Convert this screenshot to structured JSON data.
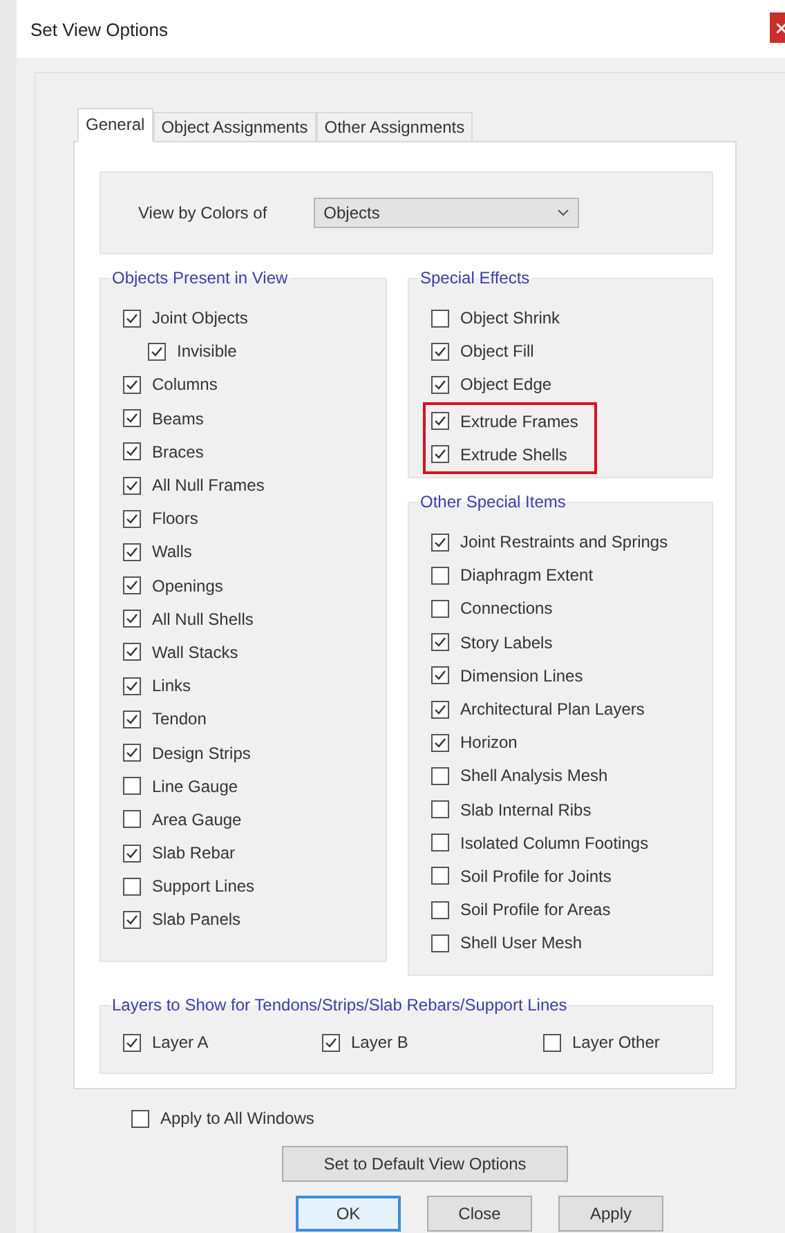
{
  "window": {
    "title": "Set View Options"
  },
  "tabs": [
    {
      "label": "General",
      "selected": true
    },
    {
      "label": "Object Assignments",
      "selected": false
    },
    {
      "label": "Other Assignments",
      "selected": false
    }
  ],
  "view_by_colors": {
    "label": "View by Colors of",
    "value": "Objects"
  },
  "objects_present": {
    "title": "Objects Present in View",
    "items": [
      {
        "label": "Joint Objects",
        "checked": true,
        "children": [
          {
            "label": "Invisible",
            "checked": true
          }
        ]
      },
      {
        "label": "Columns",
        "checked": true
      },
      {
        "label": "Beams",
        "checked": true
      },
      {
        "label": "Braces",
        "checked": true
      },
      {
        "label": "All Null Frames",
        "checked": true
      },
      {
        "label": "Floors",
        "checked": true
      },
      {
        "label": "Walls",
        "checked": true
      },
      {
        "label": "Openings",
        "checked": true
      },
      {
        "label": "All Null Shells",
        "checked": true
      },
      {
        "label": "Wall Stacks",
        "checked": true
      },
      {
        "label": "Links",
        "checked": true
      },
      {
        "label": "Tendon",
        "checked": true
      },
      {
        "label": "Design Strips",
        "checked": true
      },
      {
        "label": "Line Gauge",
        "checked": false
      },
      {
        "label": "Area Gauge",
        "checked": false
      },
      {
        "label": "Slab Rebar",
        "checked": true
      },
      {
        "label": "Support Lines",
        "checked": false
      },
      {
        "label": "Slab Panels",
        "checked": true
      }
    ]
  },
  "special_effects": {
    "title": "Special Effects",
    "items": [
      {
        "label": "Object Shrink",
        "checked": false,
        "highlighted": false
      },
      {
        "label": "Object Fill",
        "checked": true,
        "highlighted": false
      },
      {
        "label": "Object Edge",
        "checked": true,
        "highlighted": false
      },
      {
        "label": "Extrude Frames",
        "checked": true,
        "highlighted": true
      },
      {
        "label": "Extrude Shells",
        "checked": true,
        "highlighted": true
      }
    ]
  },
  "other_special_items": {
    "title": "Other Special Items",
    "items": [
      {
        "label": "Joint Restraints and Springs",
        "checked": true
      },
      {
        "label": "Diaphragm Extent",
        "checked": false
      },
      {
        "label": "Connections",
        "checked": false
      },
      {
        "label": "Story Labels",
        "checked": true
      },
      {
        "label": "Dimension Lines",
        "checked": true
      },
      {
        "label": "Architectural Plan Layers",
        "checked": true
      },
      {
        "label": "Horizon",
        "checked": true
      },
      {
        "label": "Shell Analysis Mesh",
        "checked": false
      },
      {
        "label": "Slab Internal Ribs",
        "checked": false
      },
      {
        "label": "Isolated Column Footings",
        "checked": false
      },
      {
        "label": "Soil Profile for Joints",
        "checked": false
      },
      {
        "label": "Soil Profile for Areas",
        "checked": false
      },
      {
        "label": "Shell User Mesh",
        "checked": false
      }
    ]
  },
  "layers": {
    "title": "Layers to Show for Tendons/Strips/Slab Rebars/Support Lines",
    "items": [
      {
        "label": "Layer A",
        "checked": true
      },
      {
        "label": "Layer B",
        "checked": true
      },
      {
        "label": "Layer Other",
        "checked": false
      }
    ]
  },
  "apply_to_all": {
    "label": "Apply to All Windows",
    "checked": false
  },
  "default_button": "Set to Default View Options",
  "buttons": [
    {
      "label": "OK",
      "default": true
    },
    {
      "label": "Close",
      "default": false
    },
    {
      "label": "Apply",
      "default": false
    }
  ]
}
